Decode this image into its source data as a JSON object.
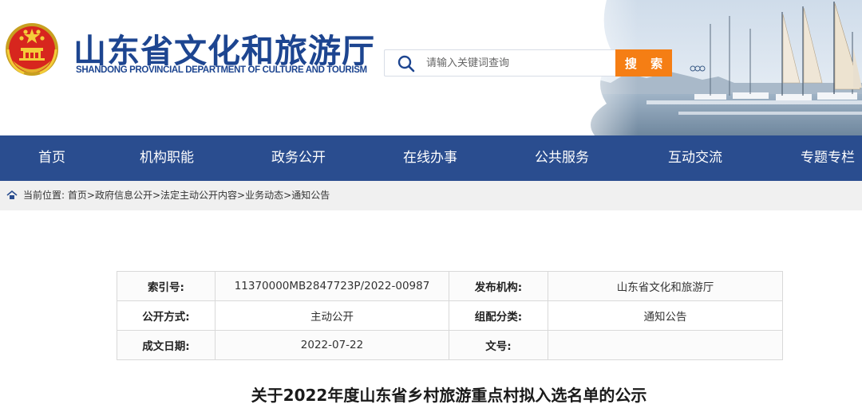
{
  "header": {
    "site_title": "山东省文化和旅游厅",
    "site_subtitle": "SHANDONG PROVINCIAL DEPARTMENT OF CULTURE AND TOURISM",
    "search": {
      "placeholder": "请输入关键词查询",
      "button_label": "搜 索"
    },
    "colors": {
      "brand_blue": "#1d4590",
      "search_button": "#f57e14"
    }
  },
  "nav": {
    "background": "#2a4d8f",
    "items": [
      "首页",
      "机构职能",
      "政务公开",
      "在线办事",
      "公共服务",
      "互动交流",
      "专题专栏"
    ]
  },
  "breadcrumb": {
    "label": "当前位置:",
    "path": [
      "首页",
      "政府信息公开",
      "法定主动公开内容",
      "业务动态",
      "通知公告"
    ],
    "separator": ">"
  },
  "meta": {
    "rows": [
      [
        {
          "label": "索引号:",
          "value": "11370000MB2847723P/2022-00987"
        },
        {
          "label": "发布机构:",
          "value": "山东省文化和旅游厅"
        }
      ],
      [
        {
          "label": "公开方式:",
          "value": "主动公开"
        },
        {
          "label": "组配分类:",
          "value": "通知公告"
        }
      ],
      [
        {
          "label": "成文日期:",
          "value": "2022-07-22"
        },
        {
          "label": "文号:",
          "value": ""
        }
      ]
    ]
  },
  "article": {
    "title": "关于2022年度山东省乡村旅游重点村拟入选名单的公示"
  }
}
